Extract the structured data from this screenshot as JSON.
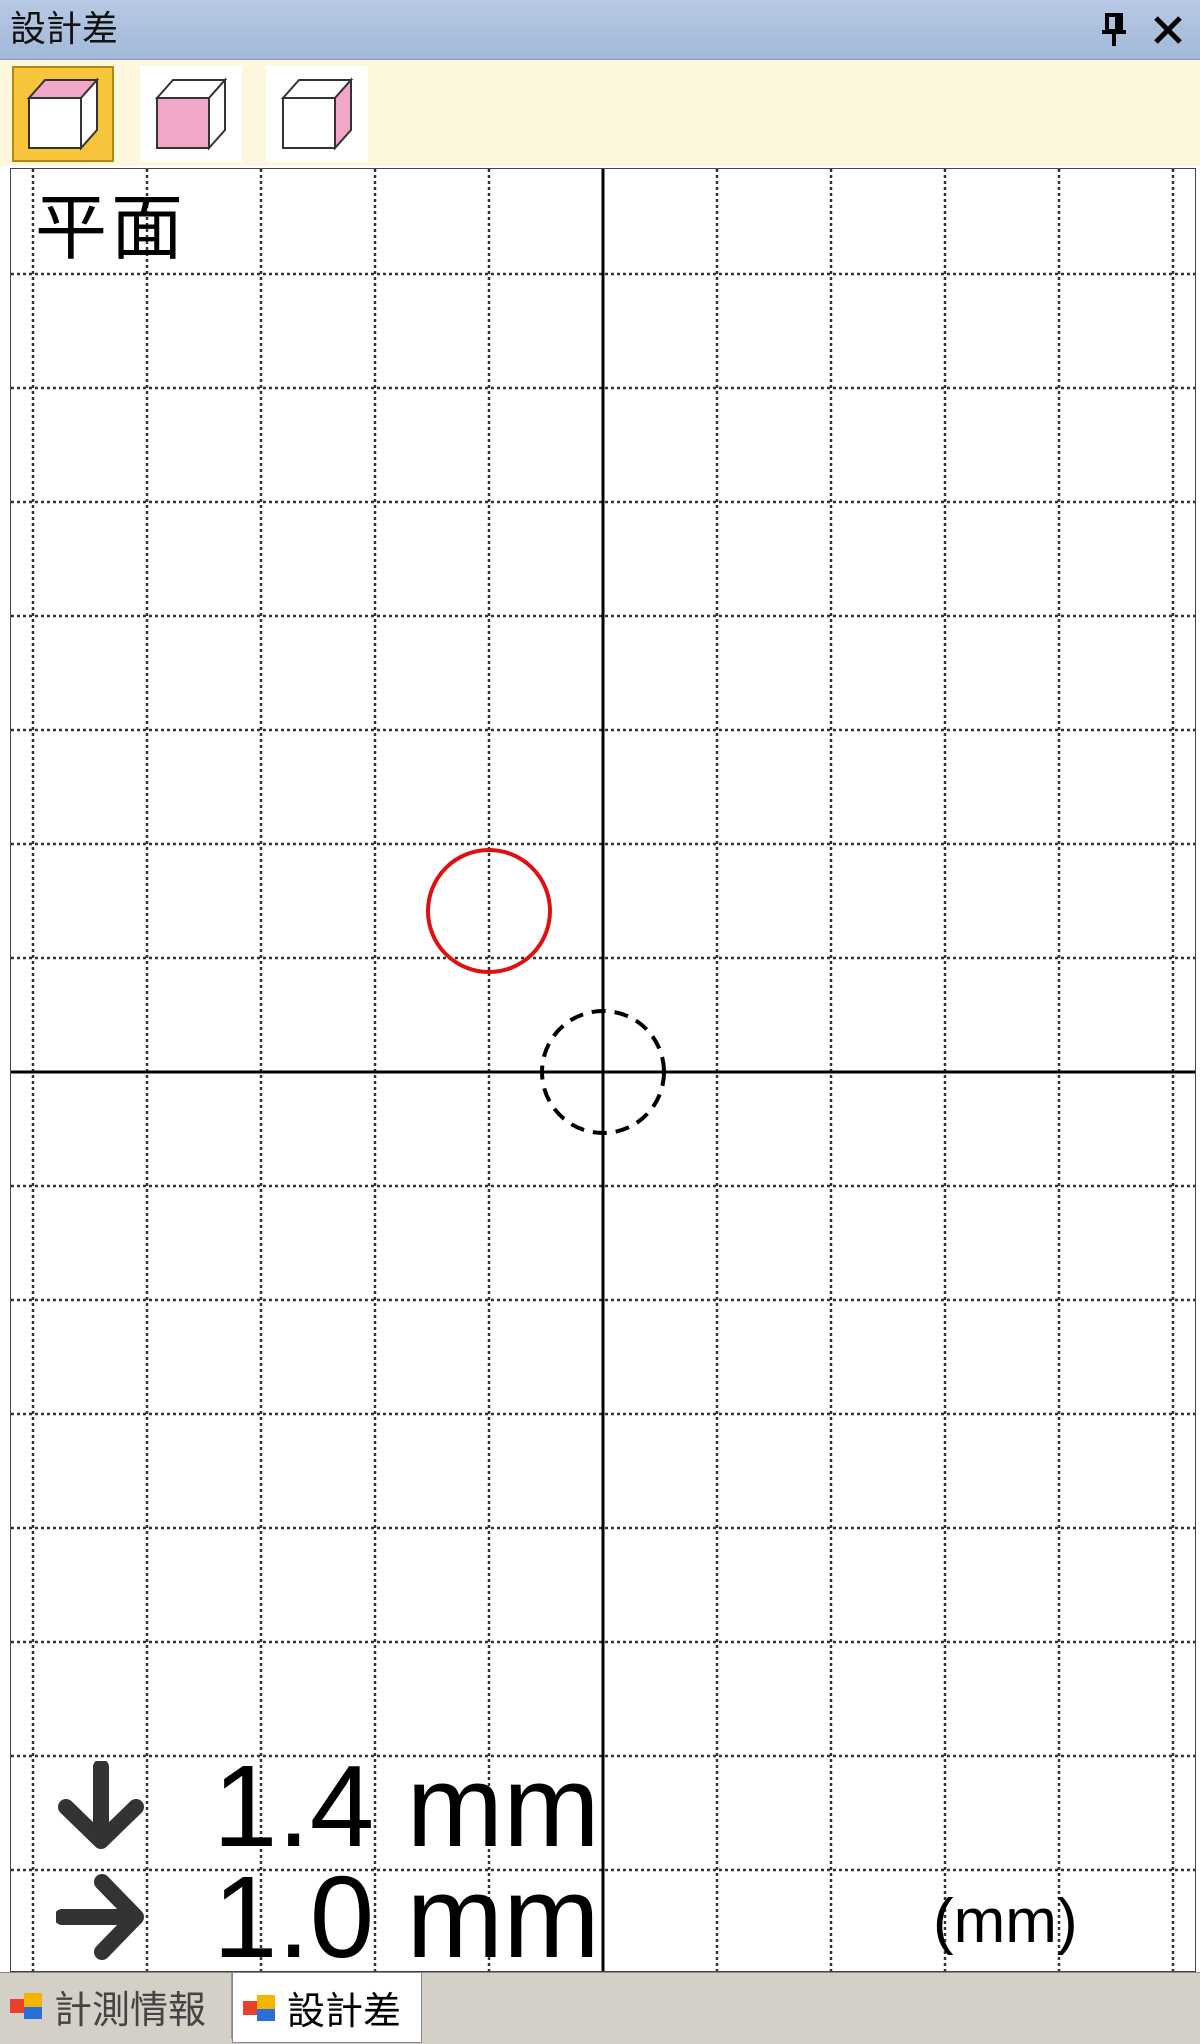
{
  "window": {
    "title": "設計差",
    "pin_icon": "pin-icon",
    "close_icon": "close-icon"
  },
  "toolbar": {
    "buttons": [
      {
        "name": "top-face-view",
        "icon": "cube-top-face-icon",
        "active": true
      },
      {
        "name": "front-face-view",
        "icon": "cube-front-face-icon",
        "active": false
      },
      {
        "name": "side-face-view",
        "icon": "cube-side-face-icon",
        "active": false
      }
    ]
  },
  "view": {
    "label": "平面",
    "unit_label": "(mm)",
    "deviation_y": "1.4 mm",
    "deviation_x": "1.0 mm",
    "deviation_y_icon": "arrow-down-icon",
    "deviation_x_icon": "arrow-right-icon",
    "grid": true,
    "design_marker_color": "#000000",
    "measured_marker_color": "#e01010"
  },
  "tabs": [
    {
      "label": "計測情報",
      "icon": "panel-tab-icon",
      "active": false
    },
    {
      "label": "設計差",
      "icon": "panel-tab-icon",
      "active": true
    }
  ]
}
